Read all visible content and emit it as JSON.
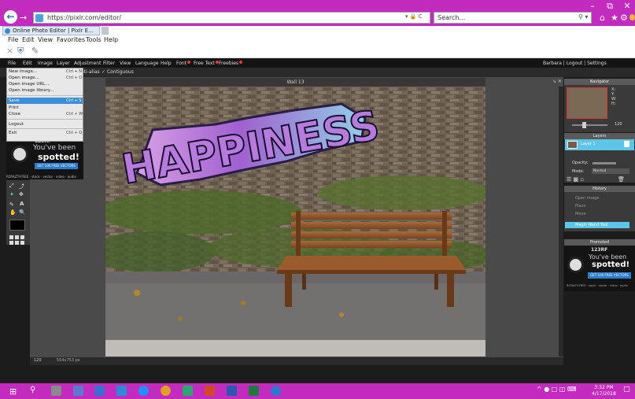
{
  "browser": {
    "url": "https://pixlr.com/editor/",
    "search_placeholder": "Search...",
    "tab_title": "Online Photo Editor | Pixlr E...",
    "menu": [
      "File",
      "Edit",
      "View",
      "Favorites",
      "Tools",
      "Help"
    ],
    "accent_color": "#c22bbd"
  },
  "pixlr": {
    "menu": [
      "File",
      "Edit",
      "Image",
      "Layer",
      "Adjustment",
      "Filter",
      "View",
      "Language",
      "Help",
      "Font",
      "Free Text",
      "Freebies"
    ],
    "user_links": "Barbara  |  Logout  |  Settings",
    "options": [
      "nti-alias",
      "Contiguous"
    ],
    "file_menu": [
      {
        "label": "New image...",
        "shortcut": "Ctrl + N"
      },
      {
        "label": "Open image...",
        "shortcut": "Ctrl + O"
      },
      {
        "label": "Open image URL...",
        "shortcut": ""
      },
      {
        "label": "Open image library...",
        "shortcut": ""
      },
      {
        "label": "Save",
        "shortcut": "Ctrl + S"
      },
      {
        "label": "Print",
        "shortcut": ""
      },
      {
        "label": "Close",
        "shortcut": "Ctrl + W"
      },
      {
        "label": "Logout",
        "shortcut": ""
      },
      {
        "label": "Exit",
        "shortcut": "Ctrl + Q"
      }
    ],
    "document": {
      "title": "Wall 13",
      "graffiti_text": "HAPPINESS",
      "zoom": "120",
      "size": "554x753 px"
    },
    "panels": {
      "navigator": {
        "title": "Navigator",
        "x": "X:",
        "y": "Y:",
        "w": "W:",
        "h": "H:",
        "zoom": "120"
      },
      "layers": {
        "title": "Layers",
        "layer_name": "Layer 1",
        "opacity_label": "Opacity:",
        "mode_label": "Mode:",
        "mode_value": "Normal"
      },
      "history": {
        "title": "History",
        "items": [
          "Open image",
          "Place",
          "Move",
          "Magic Wand Tool"
        ],
        "active": "Magic Wand Tool"
      }
    },
    "ad": {
      "logo": "123RF",
      "line1": "You've been",
      "line2": "spotted!",
      "button": "GET 100 FREE VECTORS",
      "footer": "ROYALTY-FREE  ·  stock  ·  vector  ·  video  ·  audio"
    },
    "promo_title": "Promoted"
  },
  "taskbar": {
    "time": "3:32 PM",
    "date": "4/17/2018"
  }
}
